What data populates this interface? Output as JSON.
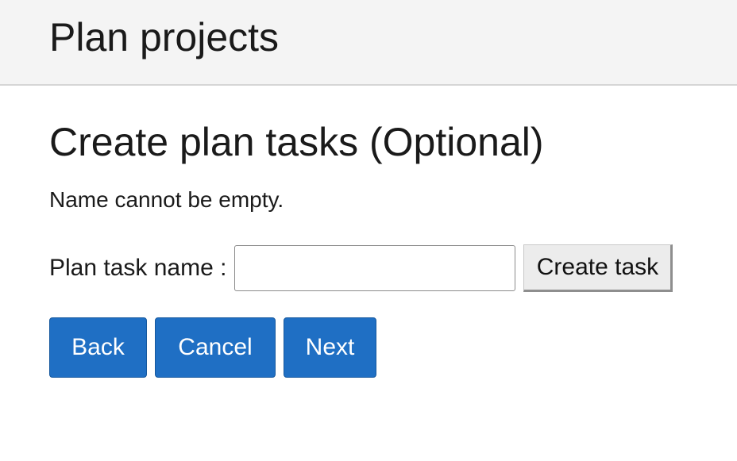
{
  "header": {
    "title": "Plan projects"
  },
  "main": {
    "page_title": "Create plan tasks (Optional)",
    "error_message": "Name cannot be empty.",
    "form": {
      "label": "Plan task name :",
      "input_value": "",
      "create_button": "Create task"
    },
    "nav": {
      "back": "Back",
      "cancel": "Cancel",
      "next": "Next"
    }
  },
  "colors": {
    "header_bg": "#f4f4f4",
    "primary_button": "#1f6fc4",
    "secondary_button": "#ececec"
  }
}
